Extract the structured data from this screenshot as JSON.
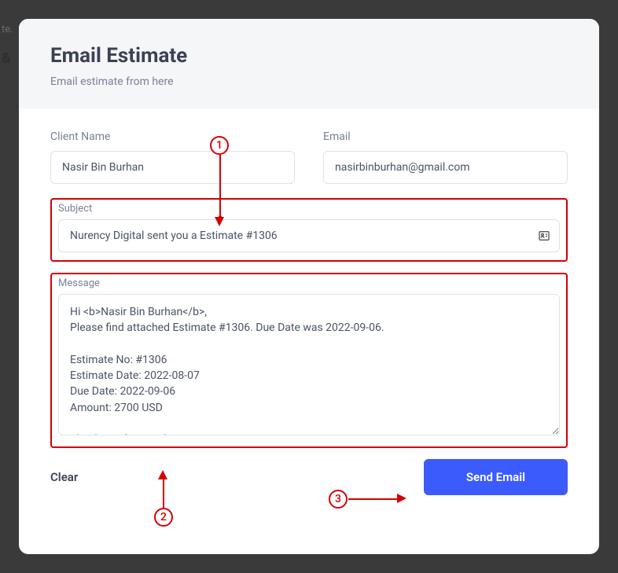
{
  "modal": {
    "title": "Email Estimate",
    "subtitle": "Email estimate from here"
  },
  "form": {
    "client_name": {
      "label": "Client Name",
      "value": "Nasir Bin Burhan"
    },
    "email": {
      "label": "Email",
      "value": "nasirbinburhan@gmail.com"
    },
    "subject": {
      "label": "Subject",
      "value": "Nurency Digital sent you a Estimate #1306"
    },
    "message": {
      "label": "Message",
      "value": "Hi <b>Nasir Bin Burhan</b>,\nPlease find attached Estimate #1306. Due Date was 2022-09-06.\n\nEstimate No: #1306\nEstimate Date: 2022-08-07\nDue Date: 2022-09-06\nAmount: 2700 USD\n\nThank you for your business."
    }
  },
  "buttons": {
    "clear": "Clear",
    "send": "Send Email"
  },
  "annotations": {
    "a1": "1",
    "a2": "2",
    "a3": "3"
  }
}
